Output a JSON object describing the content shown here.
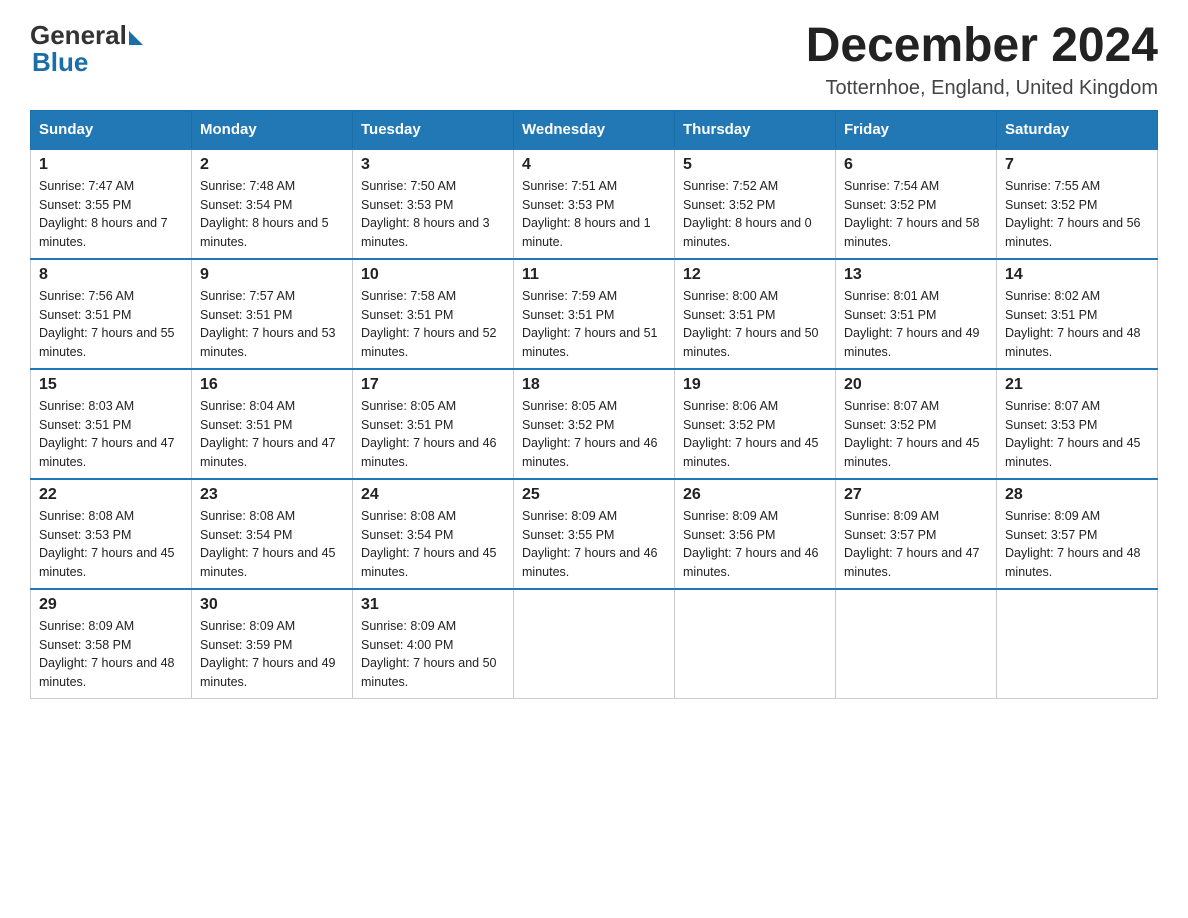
{
  "logo": {
    "general": "General",
    "blue": "Blue"
  },
  "title": "December 2024",
  "subtitle": "Totternhoe, England, United Kingdom",
  "days_header": [
    "Sunday",
    "Monday",
    "Tuesday",
    "Wednesday",
    "Thursday",
    "Friday",
    "Saturday"
  ],
  "weeks": [
    [
      {
        "day": "1",
        "sunrise": "7:47 AM",
        "sunset": "3:55 PM",
        "daylight": "8 hours and 7 minutes."
      },
      {
        "day": "2",
        "sunrise": "7:48 AM",
        "sunset": "3:54 PM",
        "daylight": "8 hours and 5 minutes."
      },
      {
        "day": "3",
        "sunrise": "7:50 AM",
        "sunset": "3:53 PM",
        "daylight": "8 hours and 3 minutes."
      },
      {
        "day": "4",
        "sunrise": "7:51 AM",
        "sunset": "3:53 PM",
        "daylight": "8 hours and 1 minute."
      },
      {
        "day": "5",
        "sunrise": "7:52 AM",
        "sunset": "3:52 PM",
        "daylight": "8 hours and 0 minutes."
      },
      {
        "day": "6",
        "sunrise": "7:54 AM",
        "sunset": "3:52 PM",
        "daylight": "7 hours and 58 minutes."
      },
      {
        "day": "7",
        "sunrise": "7:55 AM",
        "sunset": "3:52 PM",
        "daylight": "7 hours and 56 minutes."
      }
    ],
    [
      {
        "day": "8",
        "sunrise": "7:56 AM",
        "sunset": "3:51 PM",
        "daylight": "7 hours and 55 minutes."
      },
      {
        "day": "9",
        "sunrise": "7:57 AM",
        "sunset": "3:51 PM",
        "daylight": "7 hours and 53 minutes."
      },
      {
        "day": "10",
        "sunrise": "7:58 AM",
        "sunset": "3:51 PM",
        "daylight": "7 hours and 52 minutes."
      },
      {
        "day": "11",
        "sunrise": "7:59 AM",
        "sunset": "3:51 PM",
        "daylight": "7 hours and 51 minutes."
      },
      {
        "day": "12",
        "sunrise": "8:00 AM",
        "sunset": "3:51 PM",
        "daylight": "7 hours and 50 minutes."
      },
      {
        "day": "13",
        "sunrise": "8:01 AM",
        "sunset": "3:51 PM",
        "daylight": "7 hours and 49 minutes."
      },
      {
        "day": "14",
        "sunrise": "8:02 AM",
        "sunset": "3:51 PM",
        "daylight": "7 hours and 48 minutes."
      }
    ],
    [
      {
        "day": "15",
        "sunrise": "8:03 AM",
        "sunset": "3:51 PM",
        "daylight": "7 hours and 47 minutes."
      },
      {
        "day": "16",
        "sunrise": "8:04 AM",
        "sunset": "3:51 PM",
        "daylight": "7 hours and 47 minutes."
      },
      {
        "day": "17",
        "sunrise": "8:05 AM",
        "sunset": "3:51 PM",
        "daylight": "7 hours and 46 minutes."
      },
      {
        "day": "18",
        "sunrise": "8:05 AM",
        "sunset": "3:52 PM",
        "daylight": "7 hours and 46 minutes."
      },
      {
        "day": "19",
        "sunrise": "8:06 AM",
        "sunset": "3:52 PM",
        "daylight": "7 hours and 45 minutes."
      },
      {
        "day": "20",
        "sunrise": "8:07 AM",
        "sunset": "3:52 PM",
        "daylight": "7 hours and 45 minutes."
      },
      {
        "day": "21",
        "sunrise": "8:07 AM",
        "sunset": "3:53 PM",
        "daylight": "7 hours and 45 minutes."
      }
    ],
    [
      {
        "day": "22",
        "sunrise": "8:08 AM",
        "sunset": "3:53 PM",
        "daylight": "7 hours and 45 minutes."
      },
      {
        "day": "23",
        "sunrise": "8:08 AM",
        "sunset": "3:54 PM",
        "daylight": "7 hours and 45 minutes."
      },
      {
        "day": "24",
        "sunrise": "8:08 AM",
        "sunset": "3:54 PM",
        "daylight": "7 hours and 45 minutes."
      },
      {
        "day": "25",
        "sunrise": "8:09 AM",
        "sunset": "3:55 PM",
        "daylight": "7 hours and 46 minutes."
      },
      {
        "day": "26",
        "sunrise": "8:09 AM",
        "sunset": "3:56 PM",
        "daylight": "7 hours and 46 minutes."
      },
      {
        "day": "27",
        "sunrise": "8:09 AM",
        "sunset": "3:57 PM",
        "daylight": "7 hours and 47 minutes."
      },
      {
        "day": "28",
        "sunrise": "8:09 AM",
        "sunset": "3:57 PM",
        "daylight": "7 hours and 48 minutes."
      }
    ],
    [
      {
        "day": "29",
        "sunrise": "8:09 AM",
        "sunset": "3:58 PM",
        "daylight": "7 hours and 48 minutes."
      },
      {
        "day": "30",
        "sunrise": "8:09 AM",
        "sunset": "3:59 PM",
        "daylight": "7 hours and 49 minutes."
      },
      {
        "day": "31",
        "sunrise": "8:09 AM",
        "sunset": "4:00 PM",
        "daylight": "7 hours and 50 minutes."
      },
      null,
      null,
      null,
      null
    ]
  ]
}
